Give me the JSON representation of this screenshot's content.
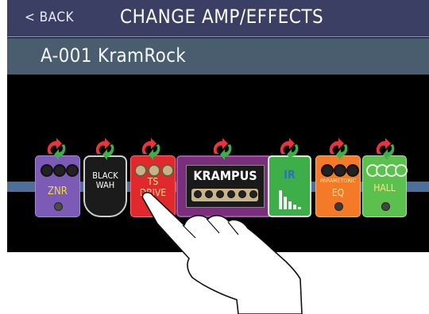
{
  "header": {
    "back_label": "< BACK",
    "title": "CHANGE AMP/EFFECTS"
  },
  "patch": {
    "name": "A-001 KramRock"
  },
  "effects_chain": [
    {
      "name": "ZNR",
      "color": "#7b5bb5"
    },
    {
      "name": "BLACK WAH",
      "color": "#2a2a2a"
    },
    {
      "name": "TS DRIVE",
      "color": "#e1282d"
    },
    {
      "name": "KRAMPUS",
      "color": "#7a2f7d"
    },
    {
      "name": "IR",
      "color": "#3eae49"
    },
    {
      "name": "PARAMETORIC EQ",
      "color": "#f47a27"
    },
    {
      "name": "HALL",
      "color": "#5cc04e"
    }
  ],
  "pedal_labels": {
    "znr": "ZNR",
    "black_wah_line1": "BLACK",
    "black_wah_line2": "WAH",
    "ts_line1": "TS",
    "ts_line2": "DRIVE",
    "krampus": "KRAMPUS",
    "ir": "IR",
    "eq_line1": "PARAMETORIC",
    "eq_line2": "EQ",
    "hall": "HALL"
  },
  "icons": {
    "swap": "swap-arrows-icon",
    "hand": "pointing-hand-icon"
  },
  "colors": {
    "topbar": "#3a3f63",
    "patchbar": "#4a5d6e",
    "signal_line": "#4d6f9a",
    "arrow_red": "#e8343a",
    "arrow_green": "#3fae49"
  }
}
